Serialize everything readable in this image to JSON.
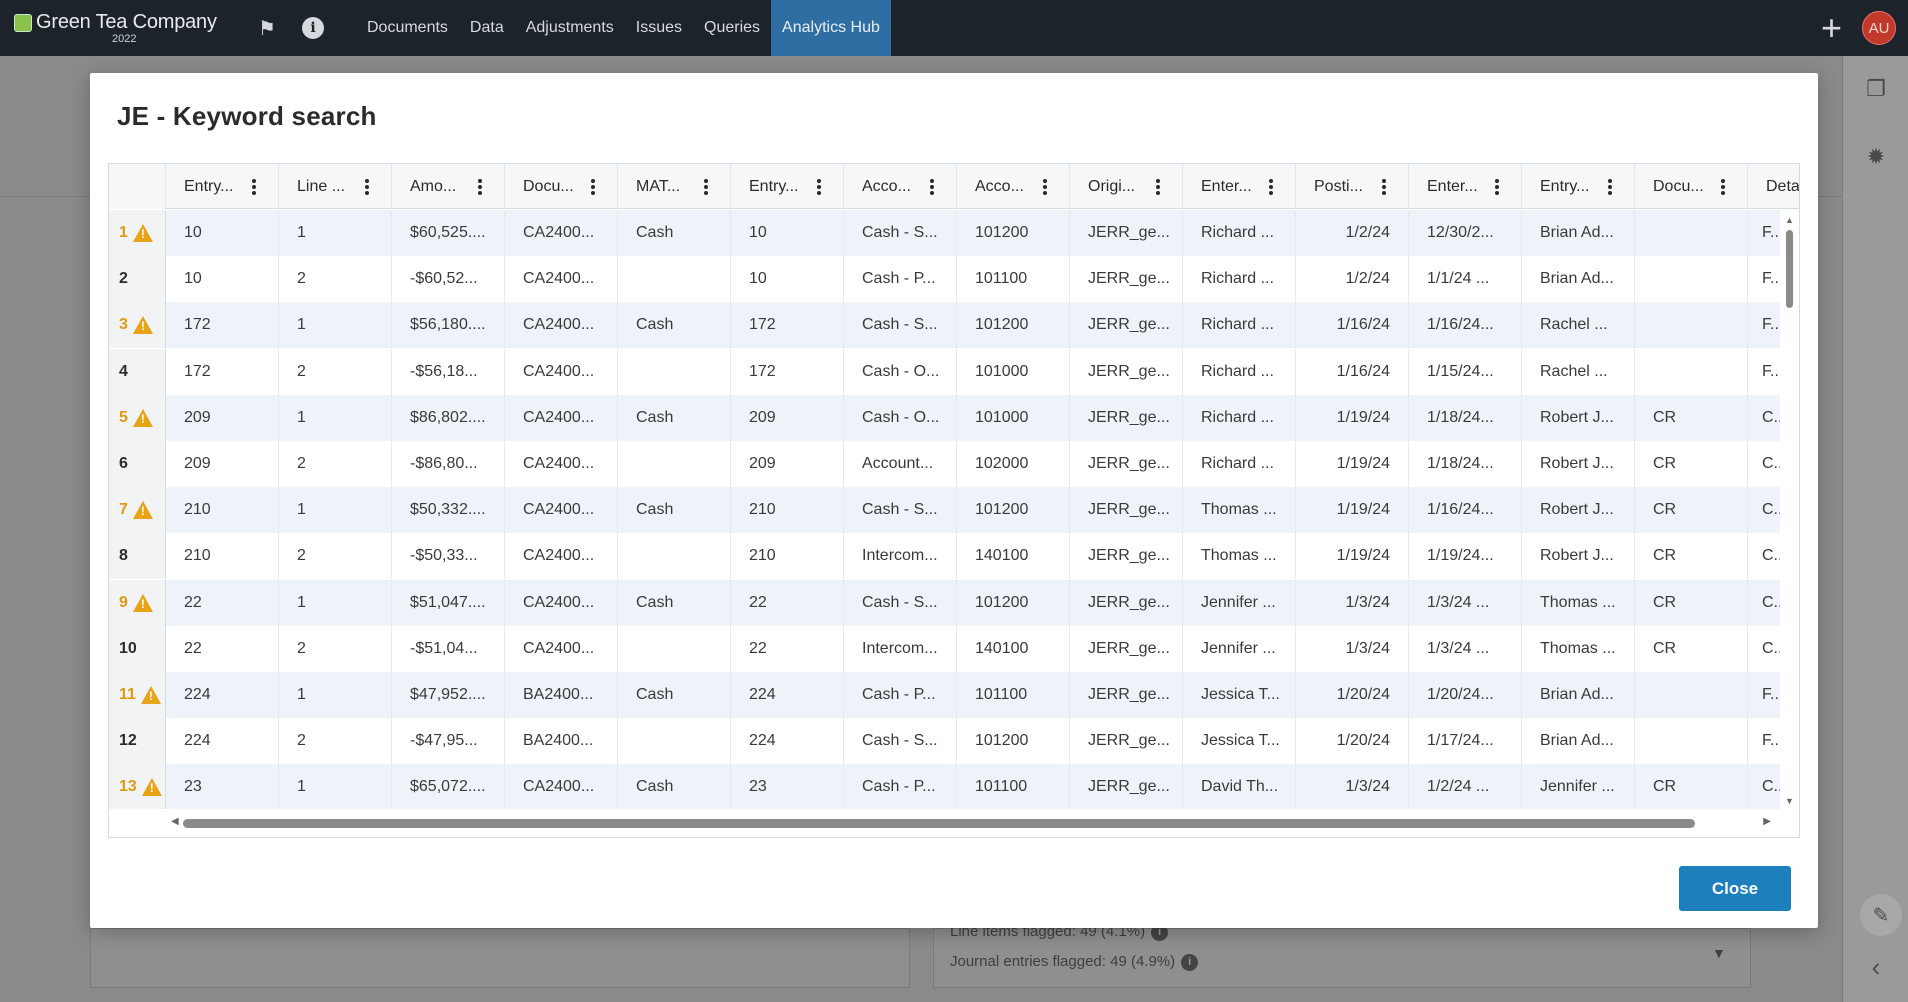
{
  "app": {
    "company": "Green Tea Company",
    "year": "2022",
    "nav": [
      "Documents",
      "Data",
      "Adjustments",
      "Issues",
      "Queries",
      "Analytics Hub"
    ],
    "active_nav": "Analytics Hub",
    "avatar_initials": "AU",
    "icons": {
      "flag": "flag-icon",
      "info": "info-icon",
      "plus": "plus-icon"
    }
  },
  "background": {
    "line_items_flagged": "Line items flagged: 49 (4.1%)",
    "journal_entries_flagged": "Journal entries flagged: 49 (4.9%)"
  },
  "modal": {
    "title": "JE - Keyword search",
    "close_label": "Close",
    "columns": [
      "Entry...",
      "Line ...",
      "Amo...",
      "Docu...",
      "MAT...",
      "Entry...",
      "Acco...",
      "Acco...",
      "Origi...",
      "Enter...",
      "Posti...",
      "Enter...",
      "Entry...",
      "Docu...",
      "Detai..."
    ],
    "rows": [
      {
        "n": "1",
        "flag": true,
        "cells": [
          "10",
          "1",
          "$60,525....",
          "CA2400...",
          "Cash",
          "10",
          "Cash - S...",
          "101200",
          "JERR_ge...",
          "Richard ...",
          "1/2/24",
          "12/30/2...",
          "Brian Ad...",
          "",
          "F..."
        ]
      },
      {
        "n": "2",
        "flag": false,
        "cells": [
          "10",
          "2",
          "-$60,52...",
          "CA2400...",
          "",
          "10",
          "Cash - P...",
          "101100",
          "JERR_ge...",
          "Richard ...",
          "1/2/24",
          "1/1/24 ...",
          "Brian Ad...",
          "",
          "F..."
        ]
      },
      {
        "n": "3",
        "flag": true,
        "cells": [
          "172",
          "1",
          "$56,180....",
          "CA2400...",
          "Cash",
          "172",
          "Cash - S...",
          "101200",
          "JERR_ge...",
          "Richard ...",
          "1/16/24",
          "1/16/24...",
          "Rachel ...",
          "",
          "F..."
        ]
      },
      {
        "n": "4",
        "flag": false,
        "cells": [
          "172",
          "2",
          "-$56,18...",
          "CA2400...",
          "",
          "172",
          "Cash - O...",
          "101000",
          "JERR_ge...",
          "Richard ...",
          "1/16/24",
          "1/15/24...",
          "Rachel ...",
          "",
          "F..."
        ]
      },
      {
        "n": "5",
        "flag": true,
        "cells": [
          "209",
          "1",
          "$86,802....",
          "CA2400...",
          "Cash",
          "209",
          "Cash - O...",
          "101000",
          "JERR_ge...",
          "Richard ...",
          "1/19/24",
          "1/18/24...",
          "Robert J...",
          "CR",
          "C..."
        ]
      },
      {
        "n": "6",
        "flag": false,
        "cells": [
          "209",
          "2",
          "-$86,80...",
          "CA2400...",
          "",
          "209",
          "Account...",
          "102000",
          "JERR_ge...",
          "Richard ...",
          "1/19/24",
          "1/18/24...",
          "Robert J...",
          "CR",
          "C..."
        ]
      },
      {
        "n": "7",
        "flag": true,
        "cells": [
          "210",
          "1",
          "$50,332....",
          "CA2400...",
          "Cash",
          "210",
          "Cash - S...",
          "101200",
          "JERR_ge...",
          "Thomas ...",
          "1/19/24",
          "1/16/24...",
          "Robert J...",
          "CR",
          "C..."
        ]
      },
      {
        "n": "8",
        "flag": false,
        "cells": [
          "210",
          "2",
          "-$50,33...",
          "CA2400...",
          "",
          "210",
          "Intercom...",
          "140100",
          "JERR_ge...",
          "Thomas ...",
          "1/19/24",
          "1/19/24...",
          "Robert J...",
          "CR",
          "C..."
        ]
      },
      {
        "n": "9",
        "flag": true,
        "cells": [
          "22",
          "1",
          "$51,047....",
          "CA2400...",
          "Cash",
          "22",
          "Cash - S...",
          "101200",
          "JERR_ge...",
          "Jennifer ...",
          "1/3/24",
          "1/3/24 ...",
          "Thomas ...",
          "CR",
          "C..."
        ]
      },
      {
        "n": "10",
        "flag": false,
        "cells": [
          "22",
          "2",
          "-$51,04...",
          "CA2400...",
          "",
          "22",
          "Intercom...",
          "140100",
          "JERR_ge...",
          "Jennifer ...",
          "1/3/24",
          "1/3/24 ...",
          "Thomas ...",
          "CR",
          "C..."
        ]
      },
      {
        "n": "11",
        "flag": true,
        "cells": [
          "224",
          "1",
          "$47,952....",
          "BA2400...",
          "Cash",
          "224",
          "Cash - P...",
          "101100",
          "JERR_ge...",
          "Jessica T...",
          "1/20/24",
          "1/20/24...",
          "Brian Ad...",
          "",
          "F..."
        ]
      },
      {
        "n": "12",
        "flag": false,
        "cells": [
          "224",
          "2",
          "-$47,95...",
          "BA2400...",
          "",
          "224",
          "Cash - S...",
          "101200",
          "JERR_ge...",
          "Jessica T...",
          "1/20/24",
          "1/17/24...",
          "Brian Ad...",
          "",
          "F..."
        ]
      },
      {
        "n": "13",
        "flag": true,
        "cells": [
          "23",
          "1",
          "$65,072....",
          "CA2400...",
          "Cash",
          "23",
          "Cash - P...",
          "101100",
          "JERR_ge...",
          "David Th...",
          "1/3/24",
          "1/2/24 ...",
          "Jennifer ...",
          "CR",
          "C..."
        ]
      }
    ]
  }
}
